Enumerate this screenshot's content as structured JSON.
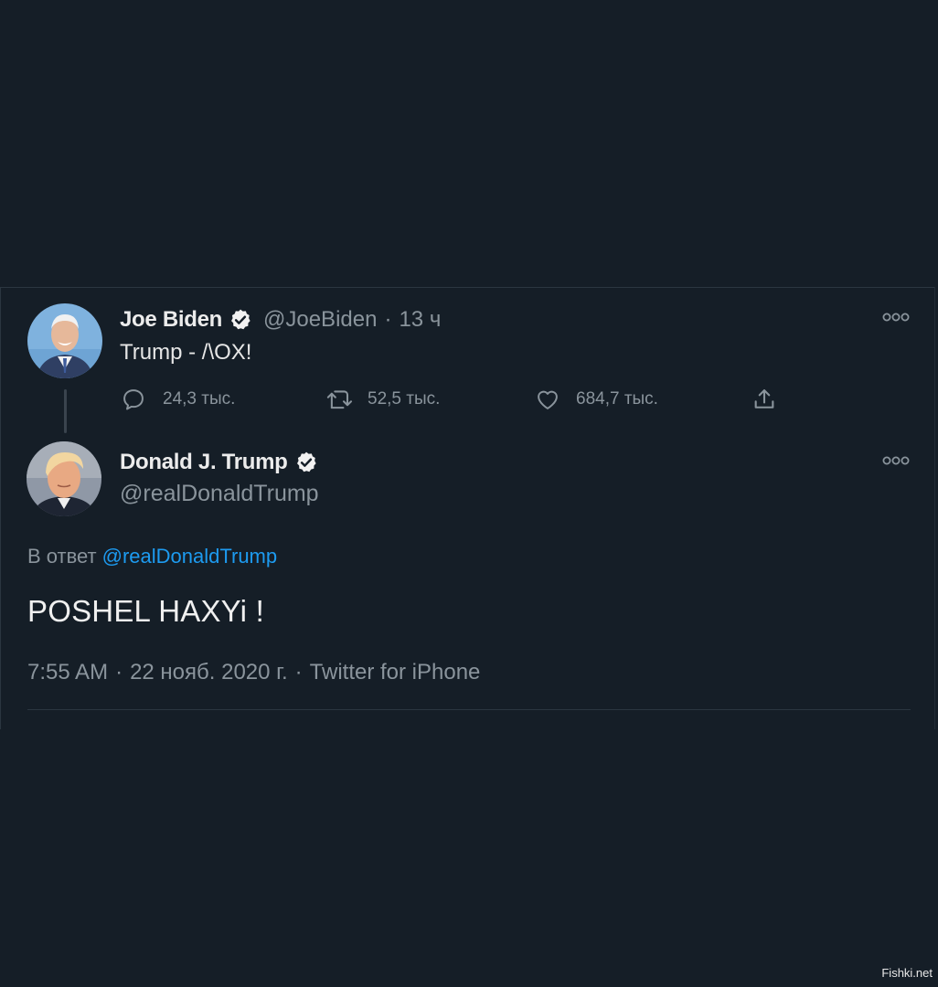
{
  "parent_tweet": {
    "display_name": "Joe Biden",
    "handle": "@JoeBiden",
    "separator": "·",
    "time_ago": "13 ч",
    "text": "Trump - /\\OX!",
    "avatar_icon": "avatar-joe-biden",
    "verified_icon": "verified-badge-icon",
    "actions": {
      "reply_count": "24,3 тыс.",
      "retweet_count": "52,5 тыс.",
      "like_count": "684,7 тыс."
    }
  },
  "main_tweet": {
    "display_name": "Donald J. Trump",
    "handle": "@realDonaldTrump",
    "avatar_icon": "avatar-donald-trump",
    "verified_icon": "verified-badge-icon",
    "reply_prefix": "В ответ",
    "reply_mention": "@realDonaldTrump",
    "text": "POSHEL HAXYi !",
    "time": "7:55 AM",
    "date": "22 нояб. 2020 г.",
    "source": "Twitter for iPhone",
    "separator": "·"
  },
  "watermark": "Fishki.net",
  "colors": {
    "background": "#151e27",
    "accent": "#1d9bf0",
    "muted_text": "#8a949c",
    "primary_text": "#ececec"
  }
}
